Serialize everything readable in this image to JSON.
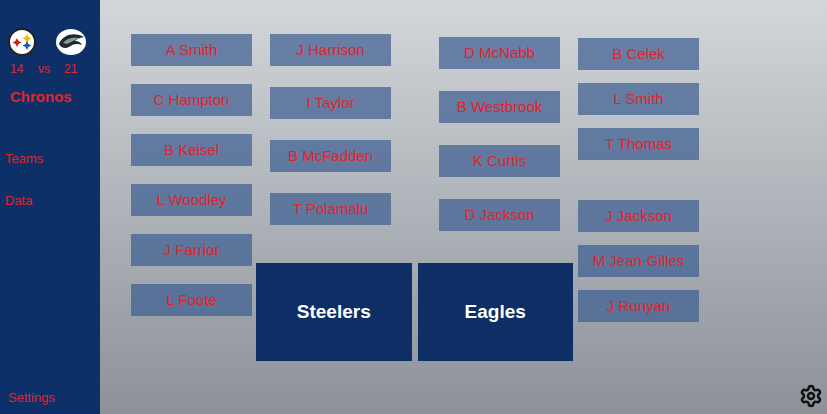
{
  "sidebar": {
    "score": {
      "home": "14",
      "separator": "vs",
      "away": "21"
    },
    "title": "Chronos",
    "items": [
      "Teams",
      "Data"
    ],
    "settings": "Settings"
  },
  "players": {
    "column1": [
      "A Smith",
      "C Hampton",
      "B Keisel",
      "L Woodley",
      "J Farrior",
      "L Foote"
    ],
    "column2": [
      "J Harrison",
      "I Taylor",
      "B McFadden",
      "T Polamalu"
    ],
    "column3": [
      "D McNabb",
      "B Westbrook",
      "K Curtis",
      "D Jackson"
    ],
    "column4": [
      "B Celek",
      "L Smith",
      "T Thomas",
      "J Jackson",
      "M Jean-Gilles",
      "J Runyan"
    ]
  },
  "teams": [
    "Steelers",
    "Eagles"
  ]
}
